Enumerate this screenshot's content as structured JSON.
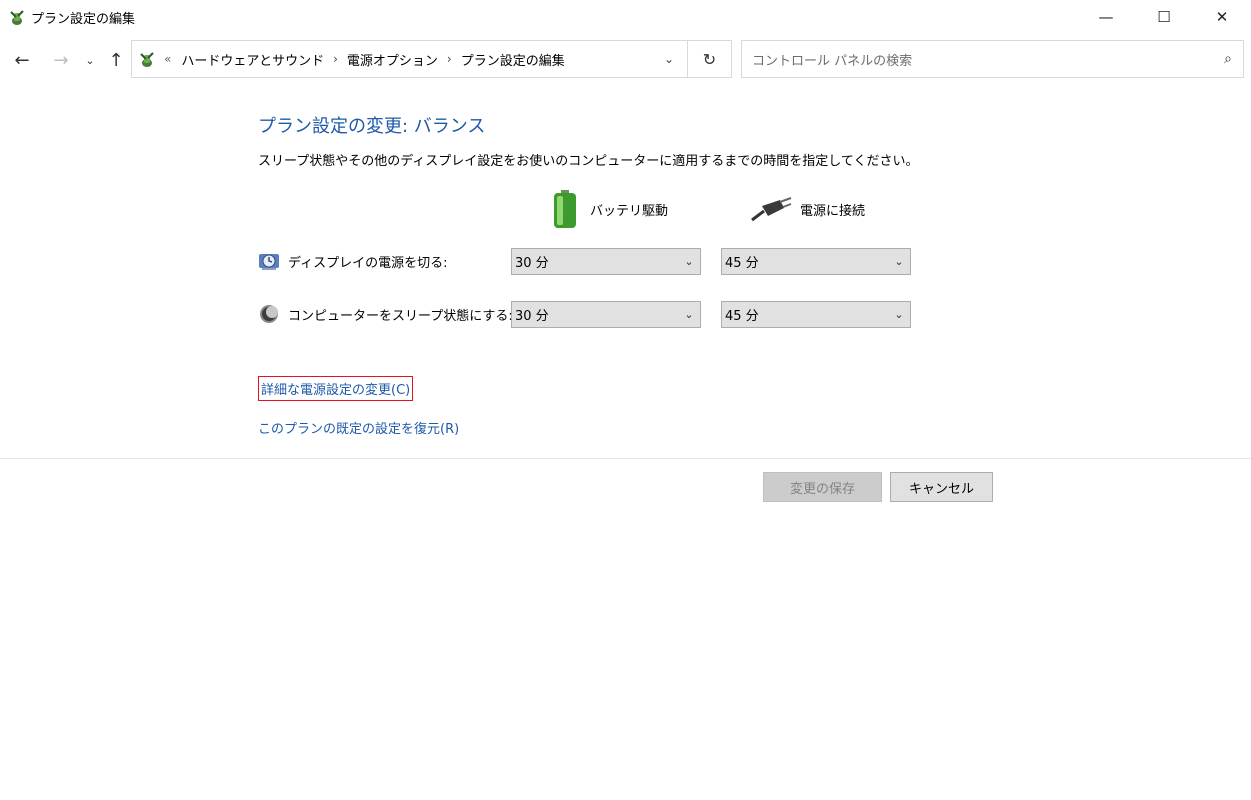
{
  "window": {
    "title": "プラン設定の編集",
    "minimize_glyph": "—",
    "maximize_glyph": "☐",
    "close_glyph": "✕"
  },
  "nav": {
    "back_glyph": "←",
    "forward_glyph": "→",
    "recent_glyph": "⌄",
    "up_glyph": "↑",
    "overflow_glyph": "«",
    "breadcrumb": [
      "ハードウェアとサウンド",
      "電源オプション",
      "プラン設定の編集"
    ],
    "separator_glyph": "›",
    "dropdown_glyph": "⌄",
    "refresh_glyph": "↻",
    "search_placeholder": "コントロール パネルの検索",
    "search_glyph": "⌕"
  },
  "main": {
    "heading": "プラン設定の変更: バランス",
    "description": "スリープ状態やその他のディスプレイ設定をお使いのコンピューターに適用するまでの時間を指定してください。",
    "columns": {
      "battery_label": "バッテリ駆動",
      "plugged_label": "電源に接続"
    },
    "settings": [
      {
        "label": "ディスプレイの電源を切る:",
        "battery_value": "30 分",
        "plugged_value": "45 分",
        "icon": "display-clock-icon"
      },
      {
        "label": "コンピューターをスリープ状態にする:",
        "battery_value": "30 分",
        "plugged_value": "45 分",
        "icon": "moon-sleep-icon"
      }
    ],
    "dropdown_glyph": "⌄",
    "advanced_link": "詳細な電源設定の変更(C)",
    "restore_link": "このプランの既定の設定を復元(R)"
  },
  "footer": {
    "save_label": "変更の保存",
    "cancel_label": "キャンセル"
  },
  "colors": {
    "link": "#1e5aa8",
    "highlight_border": "#e81123",
    "dropdown_bg": "#e1e1e1",
    "disabled_text": "#838383"
  }
}
